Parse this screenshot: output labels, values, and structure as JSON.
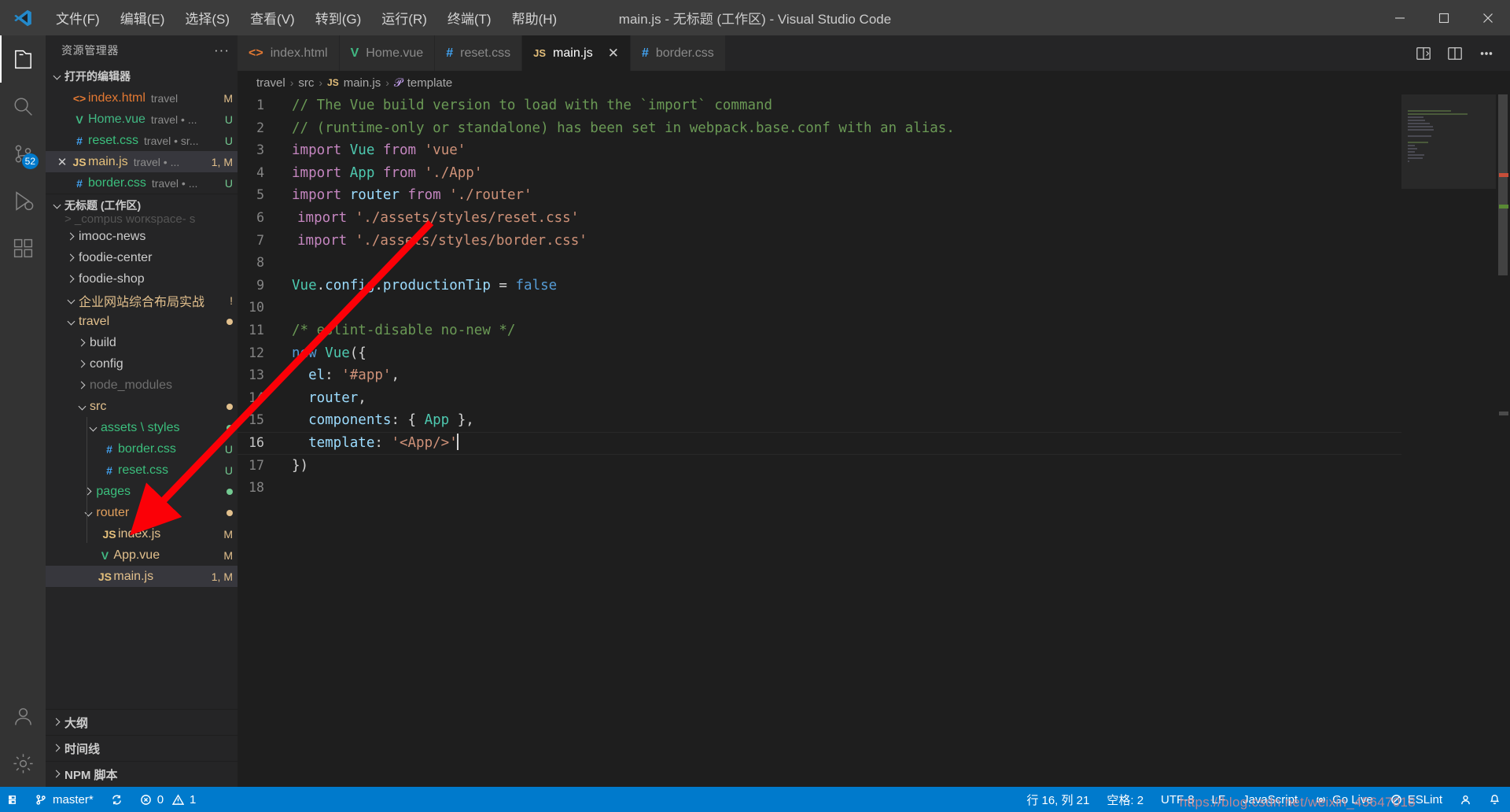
{
  "window": {
    "title": "main.js - 无标题 (工作区) - Visual Studio Code",
    "minimize": "–",
    "maximize": "□",
    "close": "✕"
  },
  "menubar": {
    "items": [
      {
        "label": "文件(F)"
      },
      {
        "label": "编辑(E)"
      },
      {
        "label": "选择(S)"
      },
      {
        "label": "查看(V)"
      },
      {
        "label": "转到(G)"
      },
      {
        "label": "运行(R)"
      },
      {
        "label": "终端(T)"
      },
      {
        "label": "帮助(H)"
      }
    ]
  },
  "activitybar": {
    "items": [
      {
        "name": "explorer",
        "icon": "files-icon",
        "active": true,
        "badge": ""
      },
      {
        "name": "search",
        "icon": "search-icon",
        "active": false,
        "badge": ""
      },
      {
        "name": "source-control",
        "icon": "source-control-icon",
        "active": false,
        "badge": "52"
      },
      {
        "name": "run-debug",
        "icon": "run-debug-icon",
        "active": false,
        "badge": ""
      },
      {
        "name": "extensions",
        "icon": "extensions-icon",
        "active": false,
        "badge": ""
      },
      {
        "name": "account",
        "icon": "account-icon",
        "active": false,
        "badge": ""
      },
      {
        "name": "settings",
        "icon": "gear-icon",
        "active": false,
        "badge": ""
      }
    ]
  },
  "sidebar": {
    "title": "资源管理器",
    "more": "···",
    "sections": {
      "open_editors": {
        "label": "打开的编辑器",
        "expanded": true,
        "items": [
          {
            "icon": "html-icon",
            "icon_glyph": "<>",
            "icon_class": "ic-html",
            "name": "index.html",
            "name_class": "c-html",
            "desc": "travel",
            "badge": "M",
            "badge_class": "b-M",
            "selected": false,
            "close": false
          },
          {
            "icon": "vue-icon",
            "icon_glyph": "V",
            "icon_class": "ic-vue",
            "name": "Home.vue",
            "name_class": "c-vue",
            "desc": "travel • ...",
            "badge": "U",
            "badge_class": "b-U",
            "selected": false,
            "close": false
          },
          {
            "icon": "css-icon",
            "icon_glyph": "#",
            "icon_class": "ic-css",
            "name": "reset.css",
            "name_class": "c-css",
            "desc": "travel • sr...",
            "badge": "U",
            "badge_class": "b-U",
            "selected": false,
            "close": false
          },
          {
            "icon": "js-icon",
            "icon_glyph": "JS",
            "icon_class": "ic-js",
            "name": "main.js",
            "name_class": "c-js",
            "desc": "travel • ...",
            "badge": "1, M",
            "badge_class": "b-M",
            "selected": true,
            "close": true
          },
          {
            "icon": "css-icon",
            "icon_glyph": "#",
            "icon_class": "ic-css",
            "name": "border.css",
            "name_class": "c-css",
            "desc": "travel • ...",
            "badge": "U",
            "badge_class": "b-U",
            "selected": false,
            "close": false
          }
        ]
      },
      "workspace": {
        "label": "无标题 (工作区)",
        "expanded": true,
        "items": [
          {
            "indent": 1,
            "arrow": "right",
            "icon": "",
            "icon_glyph": "",
            "icon_class": "",
            "name": "imooc-news",
            "name_class": "c-folder",
            "badge": "",
            "badge_class": "",
            "dot": ""
          },
          {
            "indent": 1,
            "arrow": "right",
            "icon": "",
            "icon_glyph": "",
            "icon_class": "",
            "name": "foodie-center",
            "name_class": "c-folder",
            "badge": "",
            "badge_class": "",
            "dot": ""
          },
          {
            "indent": 1,
            "arrow": "right",
            "icon": "",
            "icon_glyph": "",
            "icon_class": "",
            "name": "foodie-shop",
            "name_class": "c-folder",
            "badge": "",
            "badge_class": "",
            "dot": ""
          },
          {
            "indent": 1,
            "arrow": "down",
            "icon": "",
            "icon_glyph": "",
            "icon_class": "",
            "name": "企业网站综合布局实战",
            "name_class": "c-yellow",
            "badge": "!",
            "badge_class": "b-warn",
            "dot": ""
          },
          {
            "indent": 1,
            "arrow": "down",
            "icon": "",
            "icon_glyph": "",
            "icon_class": "",
            "name": "travel",
            "name_class": "c-yellow",
            "badge": "",
            "badge_class": "",
            "dot": "#e2c08d"
          },
          {
            "indent": 2,
            "arrow": "right",
            "icon": "",
            "icon_glyph": "",
            "icon_class": "",
            "name": "build",
            "name_class": "c-folder",
            "badge": "",
            "badge_class": "",
            "dot": ""
          },
          {
            "indent": 2,
            "arrow": "right",
            "icon": "",
            "icon_glyph": "",
            "icon_class": "",
            "name": "config",
            "name_class": "c-folder",
            "badge": "",
            "badge_class": "",
            "dot": ""
          },
          {
            "indent": 2,
            "arrow": "right",
            "icon": "",
            "icon_glyph": "",
            "icon_class": "",
            "name": "node_modules",
            "name_class": "c-dim",
            "badge": "",
            "badge_class": "",
            "dot": ""
          },
          {
            "indent": 2,
            "arrow": "down",
            "icon": "",
            "icon_glyph": "",
            "icon_class": "",
            "name": "src",
            "name_class": "c-yellow",
            "badge": "",
            "badge_class": "",
            "dot": "#e2c08d"
          },
          {
            "indent": 3,
            "arrow": "down",
            "icon": "",
            "icon_glyph": "",
            "icon_class": "",
            "name": "assets \\ styles",
            "name_class": "c-green",
            "badge": "",
            "badge_class": "",
            "dot": "#73c991"
          },
          {
            "indent": 3,
            "arrow": "none",
            "icon": "css-icon",
            "icon_glyph": "#",
            "icon_class": "ic-css",
            "name": "border.css",
            "name_class": "c-green",
            "badge": "U",
            "badge_class": "b-U",
            "dot": ""
          },
          {
            "indent": 3,
            "arrow": "none",
            "icon": "css-icon",
            "icon_glyph": "#",
            "icon_class": "ic-css",
            "name": "reset.css",
            "name_class": "c-green",
            "badge": "U",
            "badge_class": "b-U",
            "dot": ""
          },
          {
            "indent": 2.6,
            "arrow": "right",
            "icon": "",
            "icon_glyph": "",
            "icon_class": "",
            "name": "pages",
            "name_class": "c-green",
            "badge": "",
            "badge_class": "",
            "dot": "#73c991"
          },
          {
            "indent": 2.6,
            "arrow": "down",
            "icon": "",
            "icon_glyph": "",
            "icon_class": "",
            "name": "router",
            "name_class": "c-orange",
            "badge": "",
            "badge_class": "",
            "dot": "#e2c08d"
          },
          {
            "indent": 3,
            "arrow": "none",
            "icon": "js-icon",
            "icon_glyph": "JS",
            "icon_class": "ic-js",
            "name": "index.js",
            "name_class": "c-yellow",
            "badge": "M",
            "badge_class": "b-M",
            "dot": ""
          },
          {
            "indent": 2.6,
            "arrow": "none",
            "icon": "vue-icon",
            "icon_glyph": "V",
            "icon_class": "ic-vue",
            "name": "App.vue",
            "name_class": "c-yellow",
            "badge": "M",
            "badge_class": "b-M",
            "dot": ""
          },
          {
            "indent": 2.6,
            "arrow": "none",
            "icon": "js-icon",
            "icon_glyph": "JS",
            "icon_class": "ic-js",
            "name": "main.js",
            "name_class": "c-yellow",
            "badge": "1, M",
            "badge_class": "b-M",
            "dot": "",
            "selected": true
          }
        ]
      },
      "panels": [
        {
          "label": "大纲"
        },
        {
          "label": "时间线"
        },
        {
          "label": "NPM 脚本"
        }
      ]
    }
  },
  "tabs": [
    {
      "icon_glyph": "<>",
      "icon_class": "ic-html",
      "label": "index.html",
      "active": false,
      "close": false
    },
    {
      "icon_glyph": "V",
      "icon_class": "ic-vue",
      "label": "Home.vue",
      "active": false,
      "close": false
    },
    {
      "icon_glyph": "#",
      "icon_class": "ic-css",
      "label": "reset.css",
      "active": false,
      "close": false
    },
    {
      "icon_glyph": "JS",
      "icon_class": "ic-js",
      "label": "main.js",
      "active": true,
      "close": true
    },
    {
      "icon_glyph": "#",
      "icon_class": "ic-css",
      "label": "border.css",
      "active": false,
      "close": false
    }
  ],
  "breadcrumb": {
    "parts": [
      "travel",
      "src",
      "main.js",
      "template"
    ],
    "separator": "›"
  },
  "code": {
    "language": "JavaScript",
    "lines": [
      {
        "n": "1",
        "modified": false,
        "current": false,
        "tokens": [
          {
            "t": "com",
            "v": "// The Vue build version to load with the `import` command"
          }
        ]
      },
      {
        "n": "2",
        "modified": false,
        "current": false,
        "tokens": [
          {
            "t": "com",
            "v": "// (runtime-only or standalone) has been set in webpack.base.conf with an alias."
          }
        ]
      },
      {
        "n": "3",
        "modified": false,
        "current": false,
        "tokens": [
          {
            "t": "kw",
            "v": "import "
          },
          {
            "t": "cls",
            "v": "Vue"
          },
          {
            "t": "pl",
            "v": " "
          },
          {
            "t": "kw",
            "v": "from"
          },
          {
            "t": "pl",
            "v": " "
          },
          {
            "t": "str",
            "v": "'vue'"
          }
        ]
      },
      {
        "n": "4",
        "modified": false,
        "current": false,
        "tokens": [
          {
            "t": "kw",
            "v": "import "
          },
          {
            "t": "cls",
            "v": "App"
          },
          {
            "t": "pl",
            "v": " "
          },
          {
            "t": "kw",
            "v": "from"
          },
          {
            "t": "pl",
            "v": " "
          },
          {
            "t": "str",
            "v": "'./App'"
          }
        ]
      },
      {
        "n": "5",
        "modified": false,
        "current": false,
        "tokens": [
          {
            "t": "kw",
            "v": "import "
          },
          {
            "t": "id",
            "v": "router"
          },
          {
            "t": "pl",
            "v": " "
          },
          {
            "t": "kw",
            "v": "from"
          },
          {
            "t": "pl",
            "v": " "
          },
          {
            "t": "str",
            "v": "'./router'"
          }
        ]
      },
      {
        "n": "6",
        "modified": true,
        "current": false,
        "tokens": [
          {
            "t": "kw",
            "v": "import "
          },
          {
            "t": "str",
            "v": "'./assets/styles/reset.css'"
          }
        ]
      },
      {
        "n": "7",
        "modified": true,
        "current": false,
        "tokens": [
          {
            "t": "kw",
            "v": "import "
          },
          {
            "t": "str",
            "v": "'./assets/styles/border.css'"
          }
        ]
      },
      {
        "n": "8",
        "modified": false,
        "current": false,
        "tokens": [
          {
            "t": "pl",
            "v": ""
          }
        ]
      },
      {
        "n": "9",
        "modified": false,
        "current": false,
        "tokens": [
          {
            "t": "cls",
            "v": "Vue"
          },
          {
            "t": "pl",
            "v": "."
          },
          {
            "t": "id",
            "v": "config"
          },
          {
            "t": "pl",
            "v": "."
          },
          {
            "t": "id",
            "v": "productionTip"
          },
          {
            "t": "pl",
            "v": " = "
          },
          {
            "t": "blue",
            "v": "false"
          }
        ]
      },
      {
        "n": "10",
        "modified": false,
        "current": false,
        "tokens": [
          {
            "t": "pl",
            "v": ""
          }
        ]
      },
      {
        "n": "11",
        "modified": false,
        "current": false,
        "tokens": [
          {
            "t": "com",
            "v": "/* eslint-disable no-new */"
          }
        ]
      },
      {
        "n": "12",
        "modified": false,
        "current": false,
        "tokens": [
          {
            "t": "blue",
            "v": "new"
          },
          {
            "t": "pl",
            "v": " "
          },
          {
            "t": "cls",
            "v": "Vue"
          },
          {
            "t": "brk",
            "v": "({"
          }
        ]
      },
      {
        "n": "13",
        "modified": false,
        "current": false,
        "tokens": [
          {
            "t": "id",
            "v": "  el"
          },
          {
            "t": "pl",
            "v": ": "
          },
          {
            "t": "str",
            "v": "'#app'"
          },
          {
            "t": "pl",
            "v": ","
          }
        ]
      },
      {
        "n": "14",
        "modified": false,
        "current": false,
        "tokens": [
          {
            "t": "id",
            "v": "  router"
          },
          {
            "t": "pl",
            "v": ","
          }
        ]
      },
      {
        "n": "15",
        "modified": false,
        "current": false,
        "tokens": [
          {
            "t": "id",
            "v": "  components"
          },
          {
            "t": "pl",
            "v": ": { "
          },
          {
            "t": "cls",
            "v": "App"
          },
          {
            "t": "pl",
            "v": " },"
          }
        ]
      },
      {
        "n": "16",
        "modified": false,
        "current": true,
        "tokens": [
          {
            "t": "id",
            "v": "  template"
          },
          {
            "t": "pl",
            "v": ": "
          },
          {
            "t": "str",
            "v": "'<App/>'"
          }
        ],
        "cursor": true
      },
      {
        "n": "17",
        "modified": false,
        "current": false,
        "tokens": [
          {
            "t": "brk",
            "v": "})"
          }
        ]
      },
      {
        "n": "18",
        "modified": false,
        "current": false,
        "tokens": [
          {
            "t": "pl",
            "v": ""
          }
        ]
      }
    ]
  },
  "statusbar": {
    "left": [
      {
        "name": "remote-indicator",
        "icon": "remote-icon",
        "label": ""
      },
      {
        "name": "branch",
        "icon": "branch-icon",
        "label": "master*"
      },
      {
        "name": "sync",
        "icon": "sync-icon",
        "label": ""
      },
      {
        "name": "problems",
        "icon": "error-icon",
        "label": "0",
        "label2": "1",
        "icon2": "warning-icon"
      }
    ],
    "right": [
      {
        "name": "cursor-position",
        "label": "行 16, 列 21"
      },
      {
        "name": "indentation",
        "label": "空格: 2"
      },
      {
        "name": "encoding",
        "label": "UTF-8"
      },
      {
        "name": "eol",
        "label": "LF"
      },
      {
        "name": "language-mode",
        "label": "JavaScript"
      },
      {
        "name": "go-live",
        "icon": "broadcast-icon",
        "label": "Go Live"
      },
      {
        "name": "eslint",
        "icon": "eslint-icon",
        "label": "ESLint"
      },
      {
        "name": "account",
        "icon": "account-icon",
        "label": ""
      },
      {
        "name": "notifications",
        "icon": "bell-icon",
        "label": ""
      }
    ]
  },
  "watermark": "https://blog.csdn.net/weixin_45647018",
  "colors": {
    "accent": "#007acc",
    "titlebar": "#3c3c3c",
    "sidebar": "#252526",
    "editor": "#1e1e1e",
    "activitybar": "#333333",
    "annotation_arrow": "#fb0007"
  }
}
